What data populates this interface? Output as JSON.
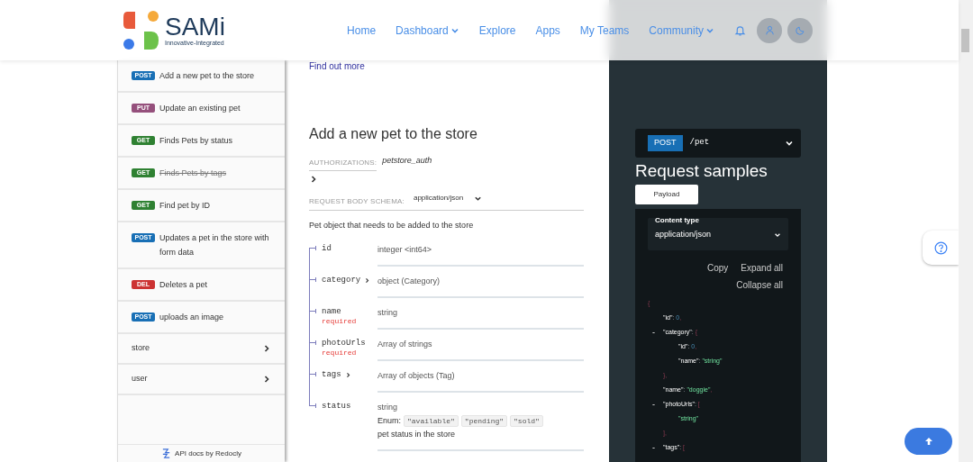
{
  "header": {
    "brand": "SAMi",
    "tagline": "Innovative-Integrated",
    "nav": [
      {
        "label": "Home",
        "dropdown": false
      },
      {
        "label": "Dashboard",
        "dropdown": true
      },
      {
        "label": "Explore",
        "dropdown": false
      },
      {
        "label": "Apps",
        "dropdown": false
      },
      {
        "label": "My Teams",
        "dropdown": false
      },
      {
        "label": "Community",
        "dropdown": true
      }
    ]
  },
  "top_link": "Find out more",
  "sidebar": {
    "operations": [
      {
        "method": "POST",
        "kind": "post",
        "label": "Add a new pet to the store",
        "deprecated": false
      },
      {
        "method": "PUT",
        "kind": "put",
        "label": "Update an existing pet",
        "deprecated": false
      },
      {
        "method": "GET",
        "kind": "get",
        "label": "Finds Pets by status",
        "deprecated": false
      },
      {
        "method": "GET",
        "kind": "get",
        "label": "Finds Pets by tags",
        "deprecated": true
      },
      {
        "method": "GET",
        "kind": "get",
        "label": "Find pet by ID",
        "deprecated": false
      },
      {
        "method": "POST",
        "kind": "post",
        "label": "Updates a pet in the store with form data",
        "deprecated": false
      },
      {
        "method": "DEL",
        "kind": "delete",
        "label": "Deletes a pet",
        "deprecated": false
      },
      {
        "method": "POST",
        "kind": "post",
        "label": "uploads an image",
        "deprecated": false
      }
    ],
    "groups": [
      {
        "label": "store"
      },
      {
        "label": "user"
      }
    ],
    "footer": "API docs by Redocly"
  },
  "operation": {
    "title": "Add a new pet to the store",
    "auth_label": "AUTHORIZATIONS:",
    "auth_value": "petstore_auth",
    "body_label": "REQUEST BODY SCHEMA:",
    "body_type": "application/json",
    "body_description": "Pet object that needs to be added to the store",
    "fields": [
      {
        "name": "id",
        "expandable": false,
        "type": "integer <int64>"
      },
      {
        "name": "category",
        "expandable": true,
        "type": "object (Category)"
      },
      {
        "name": "name",
        "expandable": false,
        "required": "required",
        "type": "string"
      },
      {
        "name": "photoUrls",
        "expandable": false,
        "required": "required",
        "type": "Array of strings"
      },
      {
        "name": "tags",
        "expandable": true,
        "type": "Array of objects (Tag)"
      },
      {
        "name": "status",
        "expandable": false,
        "type": "string",
        "enum_label": "Enum:",
        "enum": [
          "\"available\"",
          "\"pending\"",
          "\"sold\""
        ],
        "description": "pet status in the store"
      }
    ]
  },
  "samples": {
    "method": "POST",
    "path": "/pet",
    "title": "Request samples",
    "tabs": [
      {
        "label": "Payload",
        "selected": true
      }
    ],
    "content_type_label": "Content type",
    "content_type": "application/json",
    "actions": [
      "Copy",
      "Expand all",
      "Collapse all"
    ],
    "code": [
      {
        "tokens": [
          {
            "kind": "punct",
            "text": "{"
          }
        ],
        "children": [
          {
            "tokens": [
              {
                "kind": "key",
                "text": "\"id\""
              },
              {
                "kind": "plain",
                "text": ": "
              },
              {
                "kind": "number",
                "text": "0"
              },
              {
                "kind": "punct",
                "text": ","
              }
            ]
          },
          {
            "toggle": "-",
            "tokens": [
              {
                "kind": "key",
                "text": "\"category\""
              },
              {
                "kind": "plain",
                "text": ": "
              },
              {
                "kind": "punct",
                "text": "{"
              }
            ],
            "children": [
              {
                "tokens": [
                  {
                    "kind": "key",
                    "text": "\"id\""
                  },
                  {
                    "kind": "plain",
                    "text": ": "
                  },
                  {
                    "kind": "number",
                    "text": "0"
                  },
                  {
                    "kind": "punct",
                    "text": ","
                  }
                ]
              },
              {
                "tokens": [
                  {
                    "kind": "key",
                    "text": "\"name\""
                  },
                  {
                    "kind": "plain",
                    "text": ": "
                  },
                  {
                    "kind": "string",
                    "text": "\"string\""
                  }
                ]
              }
            ],
            "close": [
              {
                "kind": "punct",
                "text": "},"
              }
            ]
          },
          {
            "tokens": [
              {
                "kind": "key",
                "text": "\"name\""
              },
              {
                "kind": "plain",
                "text": ": "
              },
              {
                "kind": "string",
                "text": "\"doggie\""
              },
              {
                "kind": "punct",
                "text": ","
              }
            ]
          },
          {
            "toggle": "-",
            "tokens": [
              {
                "kind": "key",
                "text": "\"photoUrls\""
              },
              {
                "kind": "plain",
                "text": ": "
              },
              {
                "kind": "punct",
                "text": "["
              }
            ],
            "children": [
              {
                "tokens": [
                  {
                    "kind": "string",
                    "text": "\"string\""
                  }
                ]
              }
            ],
            "close": [
              {
                "kind": "punct",
                "text": "],"
              }
            ]
          },
          {
            "toggle": "-",
            "tokens": [
              {
                "kind": "key",
                "text": "\"tags\""
              },
              {
                "kind": "plain",
                "text": ": "
              },
              {
                "kind": "punct",
                "text": "["
              }
            ]
          }
        ]
      }
    ]
  }
}
